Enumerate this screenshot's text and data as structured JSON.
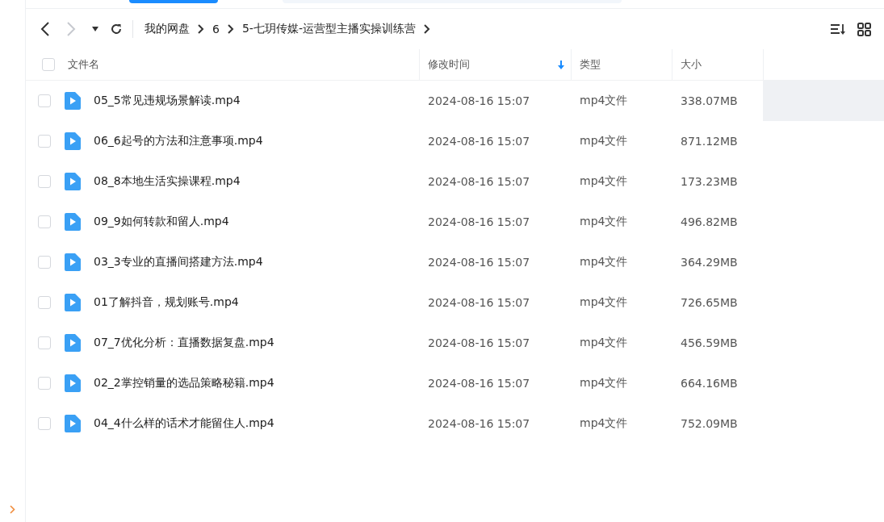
{
  "breadcrumb": [
    "我的网盘",
    "6",
    "5-七玥传媒-运营型主播实操训练营"
  ],
  "select_all_checked": false,
  "columns": [
    {
      "label": "文件名",
      "sorted": false
    },
    {
      "label": "修改时间",
      "sorted": true
    },
    {
      "label": "类型",
      "sorted": false
    },
    {
      "label": "大小",
      "sorted": false
    }
  ],
  "rows": [
    {
      "name": "05_5常见违规场景解读.mp4",
      "modified": "2024-08-16 15:07",
      "type": "mp4文件",
      "size": "338.07MB",
      "checked": false,
      "highlighted": true
    },
    {
      "name": "06_6起号的方法和注意事项.mp4",
      "modified": "2024-08-16 15:07",
      "type": "mp4文件",
      "size": "871.12MB",
      "checked": false,
      "highlighted": false
    },
    {
      "name": "08_8本地生活实操课程.mp4",
      "modified": "2024-08-16 15:07",
      "type": "mp4文件",
      "size": "173.23MB",
      "checked": false,
      "highlighted": false
    },
    {
      "name": "09_9如何转款和留人.mp4",
      "modified": "2024-08-16 15:07",
      "type": "mp4文件",
      "size": "496.82MB",
      "checked": false,
      "highlighted": false
    },
    {
      "name": "03_3专业的直播间搭建方法.mp4",
      "modified": "2024-08-16 15:07",
      "type": "mp4文件",
      "size": "364.29MB",
      "checked": false,
      "highlighted": false
    },
    {
      "name": "01了解抖音，规划账号.mp4",
      "modified": "2024-08-16 15:07",
      "type": "mp4文件",
      "size": "726.65MB",
      "checked": false,
      "highlighted": false
    },
    {
      "name": "07_7优化分析：直播数据复盘.mp4",
      "modified": "2024-08-16 15:07",
      "type": "mp4文件",
      "size": "456.59MB",
      "checked": false,
      "highlighted": false
    },
    {
      "name": "02_2掌控销量的选品策略秘籍.mp4",
      "modified": "2024-08-16 15:07",
      "type": "mp4文件",
      "size": "664.16MB",
      "checked": false,
      "highlighted": false
    },
    {
      "name": "04_4什么样的话术才能留住人.mp4",
      "modified": "2024-08-16 15:07",
      "type": "mp4文件",
      "size": "752.09MB",
      "checked": false,
      "highlighted": false
    }
  ]
}
